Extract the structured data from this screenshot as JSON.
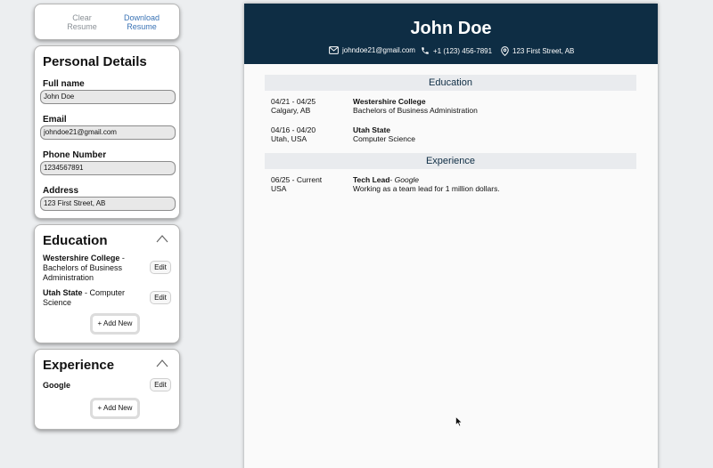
{
  "actions": {
    "clear_label": "Clear Resume",
    "download_label": "Download Resume"
  },
  "personal": {
    "title": "Personal Details",
    "fields": [
      {
        "label": "Full name",
        "value": "John Doe"
      },
      {
        "label": "Email",
        "value": "johndoe21@gmail.com"
      },
      {
        "label": "Phone Number",
        "value": "1234567891"
      },
      {
        "label": "Address",
        "value": "123 First Street, AB"
      }
    ]
  },
  "education_editor": {
    "title": "Education",
    "entries": [
      {
        "school": "Westershire College",
        "sep": " - ",
        "degree": "Bachelors of Business Administration"
      },
      {
        "school": "Utah State",
        "sep": " - ",
        "degree": "Computer Science"
      }
    ],
    "edit_label": "Edit",
    "add_label": "+ Add New"
  },
  "experience_editor": {
    "title": "Experience",
    "entries": [
      {
        "company": "Google"
      }
    ],
    "edit_label": "Edit",
    "add_label": "+ Add New"
  },
  "resume": {
    "name": "John Doe",
    "email": "johndoe21@gmail.com",
    "phone": "+1 (123) 456-7891",
    "address": "123 First Street, AB",
    "header_color": "#0e2d44",
    "education_heading": "Education",
    "education": [
      {
        "dates": "04/21 - 04/25",
        "location": "Calgary, AB",
        "school": "Westershire College",
        "degree": "Bachelors of Business Administration"
      },
      {
        "dates": "04/16 - 04/20",
        "location": "Utah, USA",
        "school": "Utah State",
        "degree": "Computer Science"
      }
    ],
    "experience_heading": "Experience",
    "experience": [
      {
        "dates": "06/25 - Current",
        "location": "USA",
        "position": "Tech Lead",
        "sep": "- ",
        "company": "Google",
        "description": "Working as a team lead for 1 million dollars."
      }
    ]
  },
  "icons": [
    "mail-icon",
    "phone-icon",
    "location-pin-icon",
    "chevron-up-icon",
    "mouse-cursor-icon"
  ]
}
